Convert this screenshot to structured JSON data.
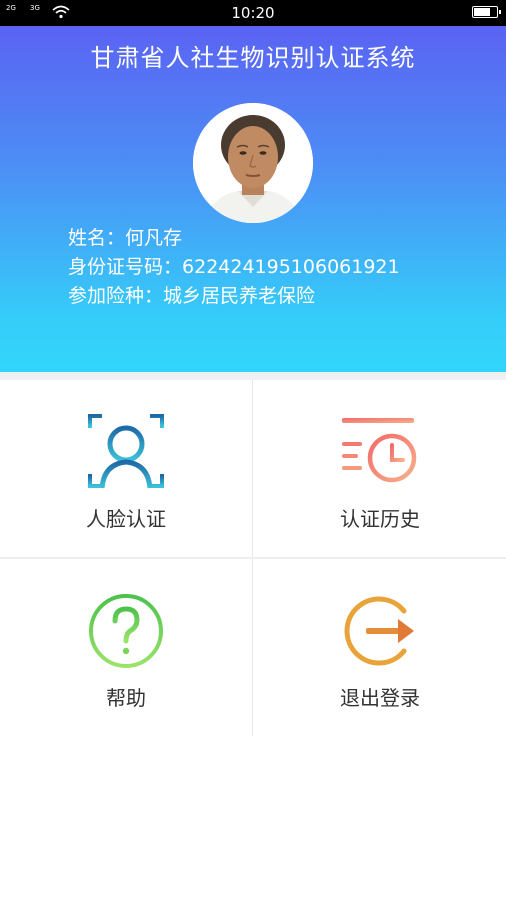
{
  "status_bar": {
    "time": "10:20",
    "signal_1": "2G",
    "signal_2": "3G"
  },
  "header": {
    "title": "甘肃省人社生物识别认证系统"
  },
  "user": {
    "name_label": "姓名：",
    "name": "何凡存",
    "id_label": "身份证号码：",
    "id_number": "622424195106061921",
    "insurance_label": "参加险种：",
    "insurance": "城乡居民养老保险"
  },
  "menu": {
    "face_auth": "人脸认证",
    "auth_history": "认证历史",
    "help": "帮助",
    "logout": "退出登录"
  },
  "colors": {
    "header_top": "#5b63f3",
    "header_bottom": "#32d6fb",
    "face_icon": "#1e7fb0",
    "history_icon": "#f2776a",
    "help_icon": "#5cc85a",
    "logout_icon": "#e8a23a"
  }
}
